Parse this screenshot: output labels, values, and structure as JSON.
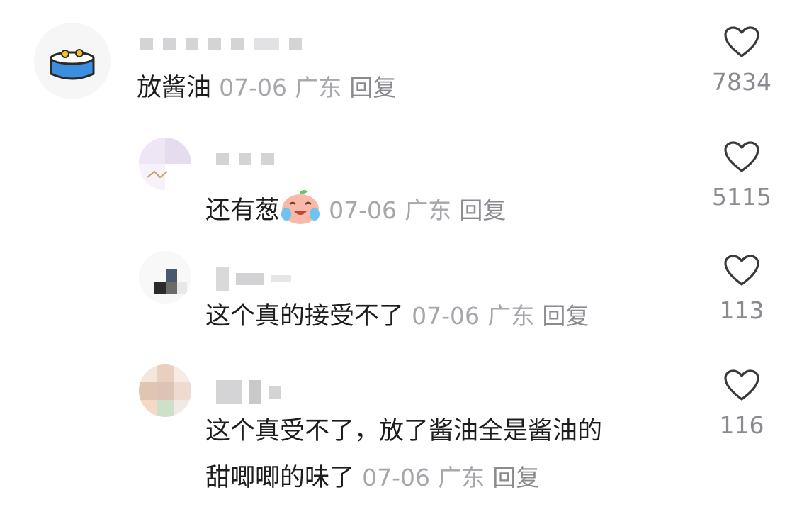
{
  "comments": [
    {
      "text": "放酱油",
      "date": "07-06",
      "location": "广东",
      "reply_label": "回复",
      "likes": "7834"
    },
    {
      "text": "还有葱",
      "emoji": "crying-laughing-peach-emoji",
      "date": "07-06",
      "location": "广东",
      "reply_label": "回复",
      "likes": "5115"
    },
    {
      "text": "这个真的接受不了",
      "date": "07-06",
      "location": "广东",
      "reply_label": "回复",
      "likes": "113"
    },
    {
      "text_line1": "这个真受不了，放了酱油全是酱油的",
      "text_line2": "甜唧唧的味了",
      "date": "07-06",
      "location": "广东",
      "reply_label": "回复",
      "likes": "116"
    }
  ],
  "icons": {
    "like": "heart-outline-icon"
  },
  "colors": {
    "text": "#1d1d1f",
    "meta": "#a6a6ab",
    "icon": "#3a3a3c"
  }
}
